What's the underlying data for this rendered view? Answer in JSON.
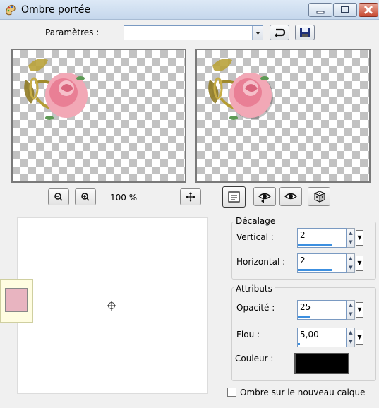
{
  "window": {
    "title": "Ombre portée"
  },
  "toolbar": {
    "params_label": "Paramètres :",
    "params_value": ""
  },
  "zoom": {
    "level": "100 %"
  },
  "offset": {
    "title": "Décalage",
    "vertical_label": "Vertical :",
    "vertical_value": "2",
    "vertical_fraction": 0.7,
    "horizontal_label": "Horizontal :",
    "horizontal_value": "2",
    "horizontal_fraction": 0.7
  },
  "attributes": {
    "title": "Attributs",
    "opacity_label": "Opacité :",
    "opacity_value": "25",
    "opacity_fraction": 0.25,
    "blur_label": "Flou :",
    "blur_value": "5,00",
    "blur_fraction": 0.05,
    "color_label": "Couleur :",
    "shadow_color": "#000000"
  },
  "swatch": {
    "color": "#e8b4c0"
  },
  "options": {
    "new_layer_label": "Ombre sur le nouveau calque",
    "new_layer_checked": false
  },
  "icons": {
    "app": "paint-palette-icon",
    "reset": "reset-arrow-icon",
    "save": "save-disk-icon",
    "zoom_out": "zoom-out-icon",
    "zoom_in": "zoom-in-icon",
    "pan": "pan-move-icon",
    "proof": "proof-preview-icon",
    "eye_left": "eye-left-icon",
    "eye": "eye-icon",
    "random": "dice-random-icon",
    "crosshair": "crosshair-icon"
  }
}
